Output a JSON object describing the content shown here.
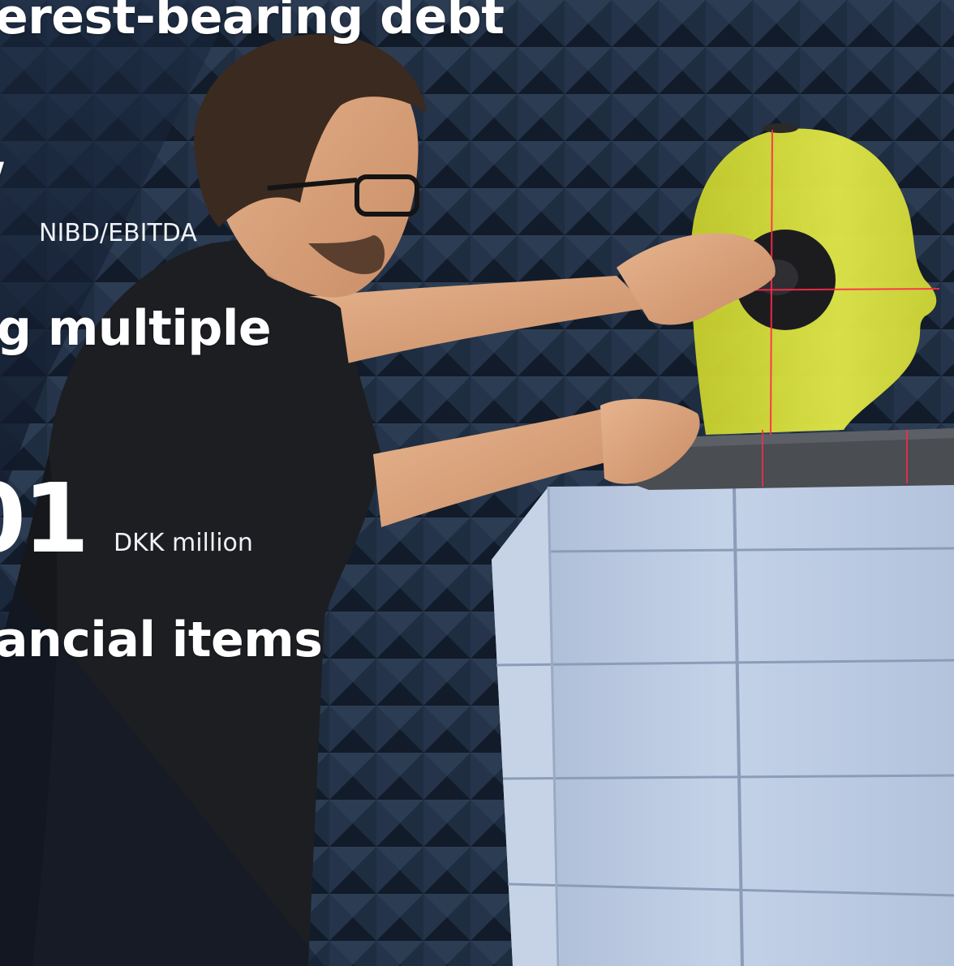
{
  "page": {
    "heading_debt": "erest-bearing debt",
    "fragment_top": "/",
    "unit_ratio": "NIBD/EBITDA",
    "heading_multiple": "g multiple",
    "big_value": "01",
    "unit_currency": "DKK million",
    "heading_items": "ancial items"
  },
  "colors": {
    "background_dark": "#1d2a3d",
    "overlay_navy": "#1a2840",
    "text": "#ffffff",
    "head_yellow": "#d8e03a",
    "laser": "#ff2a4a",
    "foam_blocks": "#b9c8e0"
  },
  "photo": {
    "subject": "technician positioning ear microphone on yellow acoustic test head in anechoic chamber"
  }
}
